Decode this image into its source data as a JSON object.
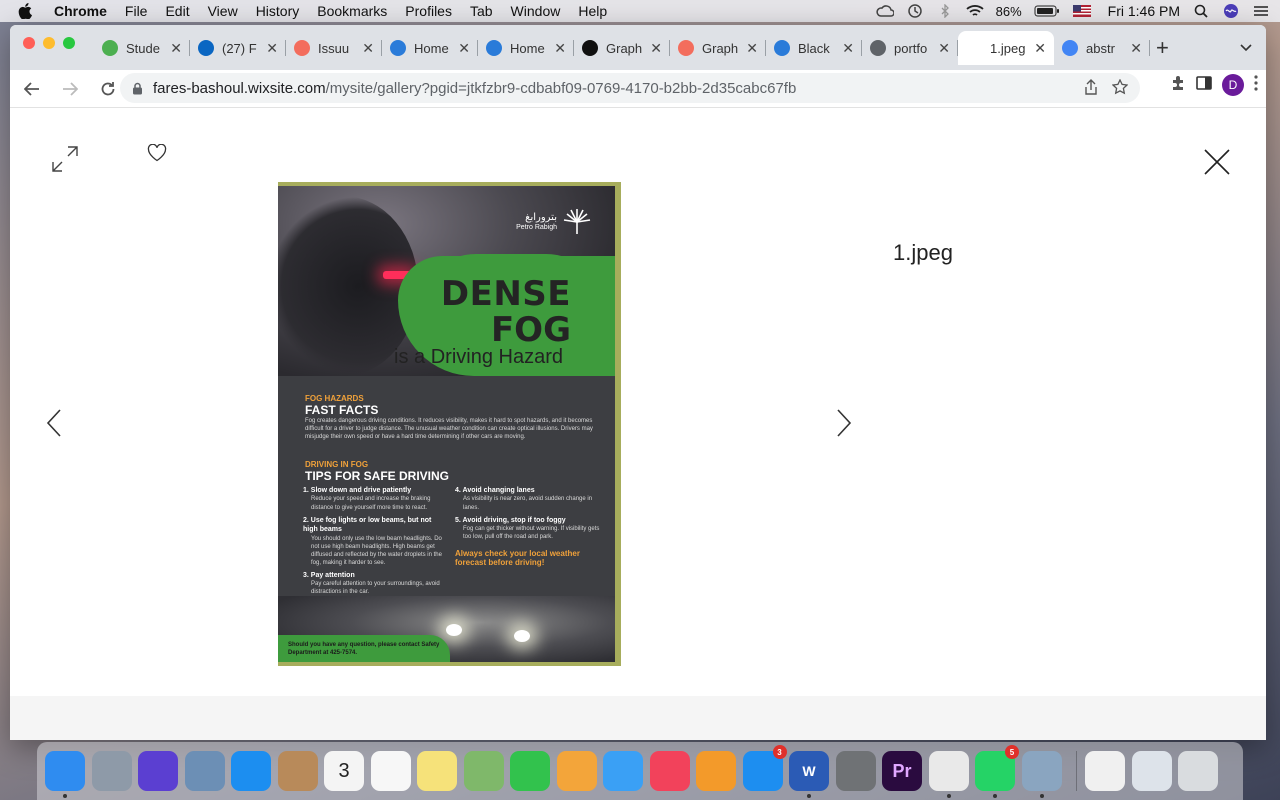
{
  "menubar": {
    "app_name": "Chrome",
    "items": [
      "File",
      "Edit",
      "View",
      "History",
      "Bookmarks",
      "Profiles",
      "Tab",
      "Window",
      "Help"
    ],
    "battery": "86%",
    "clock": "Fri 1:46 PM"
  },
  "browser": {
    "tabs": [
      {
        "label": "Stude",
        "favicon": "leaf-icon",
        "color": "#4caf50"
      },
      {
        "label": "(27) F",
        "favicon": "linkedin-icon",
        "color": "#0a66c2"
      },
      {
        "label": "Issuu",
        "favicon": "issuu-icon",
        "color": "#f36d5d"
      },
      {
        "label": "Home",
        "favicon": "canva-icon",
        "color": "#2a7bd9"
      },
      {
        "label": "Home",
        "favicon": "canva-icon",
        "color": "#2a7bd9"
      },
      {
        "label": "Graph",
        "favicon": "studocu-icon",
        "color": "#111111"
      },
      {
        "label": "Graph",
        "favicon": "issuu-icon",
        "color": "#f36d5d"
      },
      {
        "label": "Black",
        "favicon": "canva-icon",
        "color": "#2a7bd9"
      },
      {
        "label": "portfo",
        "favicon": "globe-icon",
        "color": "#5f6368"
      },
      {
        "label": "1.jpeg",
        "favicon": "",
        "color": "#ffffff"
      },
      {
        "label": "abstr",
        "favicon": "google-icon",
        "color": "#4285f4"
      }
    ],
    "url_host": "fares-bashoul.wixsite.com",
    "url_path": "/mysite/gallery?pgid=jtkfzbr9-cdbabf09-0769-4170-b2bb-2d35cabc67fb",
    "profile_initial": "D"
  },
  "lightbox": {
    "filename": "1.jpeg"
  },
  "poster": {
    "logo_arabic": "بترورابغ",
    "logo_english": "Petro Rabigh",
    "title_line1": "DENSE",
    "title_line2": "FOG",
    "subtitle": "is a Driving Hazard",
    "section1_kicker": "FOG HAZARDS",
    "section1_head": "FAST FACTS",
    "section1_body": "Fog creates dangerous driving conditions. It reduces visibility, makes it hard to spot hazards, and it becomes difficult for a driver to judge distance. The unusual weather condition can create optical illusions. Drivers may misjudge their own speed or have a hard time determining if other cars are moving.",
    "section2_kicker": "DRIVING IN FOG",
    "section2_head": "TIPS FOR SAFE DRIVING",
    "tips_left": [
      {
        "title": "1. Slow down and drive patiently",
        "body": "Reduce your speed and increase the braking distance to give yourself more time to react."
      },
      {
        "title": "2. Use fog lights or low beams, but not high beams",
        "body": "You should only use the low beam headlights. Do not use high beam headlights. High beams get diffused and reflected by the water droplets in the fog, making it harder to see."
      },
      {
        "title": "3. Pay attention",
        "body": "Pay careful attention to your surroundings, avoid distractions in the car."
      }
    ],
    "tips_right": [
      {
        "title": "4. Avoid changing lanes",
        "body": "As visibility is near zero, avoid sudden change in lanes."
      },
      {
        "title": "5. Avoid driving, stop if too foggy",
        "body": "Fog can get thicker without warning. If visibility gets too low, pull off the road and park."
      }
    ],
    "orange_note": "Always check your local weather forecast before driving!",
    "contact": "Should you have any question, please contact Safety Department at 425-7574."
  },
  "dock": {
    "apps": [
      {
        "name": "finder-icon",
        "color": "#2f8cf0",
        "label": "",
        "badge": "",
        "running": true
      },
      {
        "name": "launchpad-icon",
        "color": "#8e9aa8",
        "label": "",
        "badge": "",
        "running": false
      },
      {
        "name": "siri-icon",
        "color": "#5b3fd1",
        "label": "",
        "badge": "",
        "running": false
      },
      {
        "name": "preview-icon",
        "color": "#6c8fb5",
        "label": "",
        "badge": "",
        "running": false
      },
      {
        "name": "safari-icon",
        "color": "#1c8ef0",
        "label": "",
        "badge": "",
        "running": false
      },
      {
        "name": "contacts-icon",
        "color": "#b88a5a",
        "label": "",
        "badge": "",
        "running": false
      },
      {
        "name": "calendar-icon",
        "color": "#f4f4f4",
        "label": "3",
        "badge": "",
        "running": false
      },
      {
        "name": "reminders-icon",
        "color": "#f7f7f7",
        "label": "",
        "badge": "",
        "running": false
      },
      {
        "name": "notes-icon",
        "color": "#f6e27a",
        "label": "",
        "badge": "",
        "running": false
      },
      {
        "name": "maps-icon",
        "color": "#7fb86a",
        "label": "",
        "badge": "",
        "running": false
      },
      {
        "name": "facetime-icon",
        "color": "#32c24d",
        "label": "",
        "badge": "",
        "running": false
      },
      {
        "name": "photos-icon",
        "color": "#f3a53a",
        "label": "",
        "badge": "",
        "running": false
      },
      {
        "name": "messages-icon",
        "color": "#3aa0f5",
        "label": "",
        "badge": "",
        "running": false
      },
      {
        "name": "music-icon",
        "color": "#f2425b",
        "label": "",
        "badge": "",
        "running": false
      },
      {
        "name": "books-icon",
        "color": "#f39a2a",
        "label": "",
        "badge": "",
        "running": false
      },
      {
        "name": "app-store-icon",
        "color": "#1d8ef0",
        "label": "",
        "badge": "3",
        "running": false
      },
      {
        "name": "word-icon",
        "color": "#2b5bb5",
        "label": "W",
        "badge": "",
        "running": true
      },
      {
        "name": "system-preferences-icon",
        "color": "#6f7275",
        "label": "",
        "badge": "",
        "running": false
      },
      {
        "name": "premiere-icon",
        "color": "#2a0b3f",
        "label": "Pr",
        "badge": "",
        "running": false
      },
      {
        "name": "chrome-icon",
        "color": "#e9e9e9",
        "label": "",
        "badge": "",
        "running": true
      },
      {
        "name": "whatsapp-icon",
        "color": "#25d366",
        "label": "",
        "badge": "5",
        "running": true
      },
      {
        "name": "image-capture-icon",
        "color": "#8aa5c0",
        "label": "",
        "badge": "",
        "running": true
      }
    ],
    "right_items": [
      {
        "name": "document-stack-icon",
        "color": "#f0f0f0"
      },
      {
        "name": "downloads-stack-icon",
        "color": "#dde3ea"
      },
      {
        "name": "trash-icon",
        "color": "#d9dcdf"
      }
    ]
  }
}
